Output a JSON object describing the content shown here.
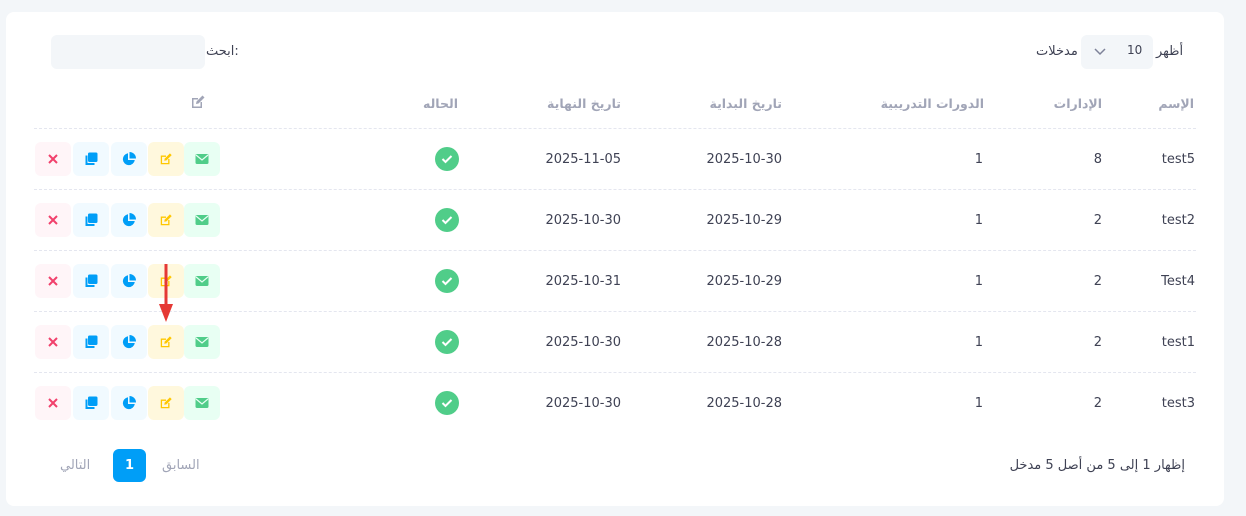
{
  "controls": {
    "show_label": "أظهر",
    "page_size": "10",
    "entries_label": "مدخلات",
    "search_label": "ابحث:",
    "search_value": ""
  },
  "table": {
    "headers": {
      "name": "الإسم",
      "departments": "الإدارات",
      "courses": "الدورات التدريبية",
      "start_date": "تاريخ البداية",
      "end_date": "تاريخ النهاية",
      "status": "الحاله",
      "actions_icon": "edit-icon"
    },
    "rows": [
      {
        "name": "test5",
        "departments": "8",
        "courses": "1",
        "start_date": "2025-10-30",
        "end_date": "2025-11-05",
        "status": "active"
      },
      {
        "name": "test2",
        "departments": "2",
        "courses": "1",
        "start_date": "2025-10-29",
        "end_date": "2025-10-30",
        "status": "active"
      },
      {
        "name": "Test4",
        "departments": "2",
        "courses": "1",
        "start_date": "2025-10-29",
        "end_date": "2025-10-31",
        "status": "active"
      },
      {
        "name": "test1",
        "departments": "2",
        "courses": "1",
        "start_date": "2025-10-28",
        "end_date": "2025-10-30",
        "status": "active"
      },
      {
        "name": "test3",
        "departments": "2",
        "courses": "1",
        "start_date": "2025-10-28",
        "end_date": "2025-10-30",
        "status": "active"
      }
    ],
    "row_actions": [
      "envelope-icon",
      "edit-icon",
      "pie-chart-icon",
      "copy-icon",
      "close-icon"
    ]
  },
  "footer": {
    "info": "إظهار 1 إلى 5 من أصل 5 مدخل",
    "prev": "السابق",
    "page": "1",
    "next": "التالي"
  },
  "colors": {
    "success": "#50cd89",
    "primary": "#009ef7",
    "warning": "#ffc700",
    "danger": "#f1416c",
    "annotation": "#e53935"
  }
}
